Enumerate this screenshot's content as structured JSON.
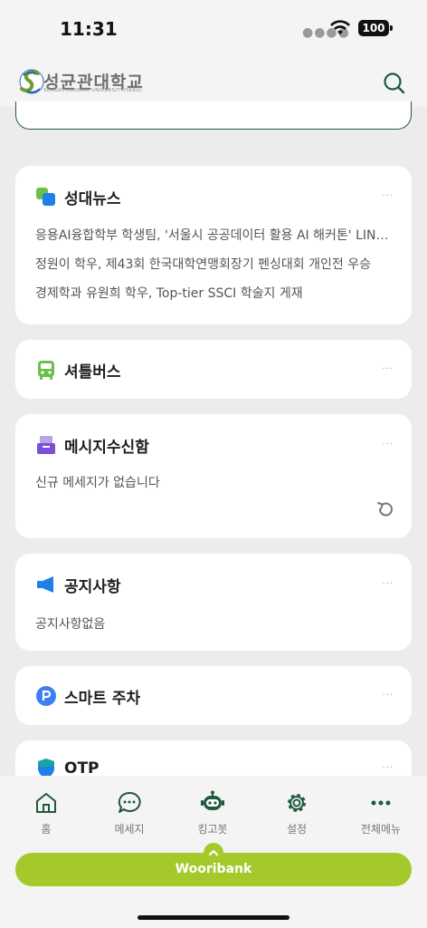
{
  "status": {
    "time": "11:31",
    "battery": "100"
  },
  "header": {
    "logo_title": "성균관대학교",
    "logo_sub": "SUNGKYUNKWAN UNIVERSITY(SKKU)"
  },
  "cards": {
    "news": {
      "title": "성대뉴스",
      "items": [
        "응용AI융합학부 학생팀, '서울시 공공데이터 활용 AI 해커톤' LIN…",
        "정원이 학우, 제43회 한국대학연맹회장기 펜싱대회 개인전 우승",
        "경제학과 유원희 학우, Top-tier SSCI 학술지 게재"
      ]
    },
    "shuttle": {
      "title": "셔틀버스"
    },
    "messages": {
      "title": "메시지수신함",
      "empty": "신규 메세지가 없습니다"
    },
    "notices": {
      "title": "공지사항",
      "empty": "공지사항없음"
    },
    "parking": {
      "title": "스마트 주차"
    },
    "otp": {
      "title": "OTP"
    },
    "more_label": "···"
  },
  "tabbar": {
    "items": [
      {
        "label": "홈",
        "icon": "home-icon"
      },
      {
        "label": "메세지",
        "icon": "chat-icon"
      },
      {
        "label": "킹고봇",
        "icon": "robot-icon"
      },
      {
        "label": "설정",
        "icon": "gear-icon"
      },
      {
        "label": "전체메뉴",
        "icon": "more-icon"
      }
    ]
  },
  "woori": {
    "label": "Wooribank"
  },
  "colors": {
    "accent_green": "#1f5a3c",
    "lime": "#a5c92a",
    "background": "#ececec"
  }
}
